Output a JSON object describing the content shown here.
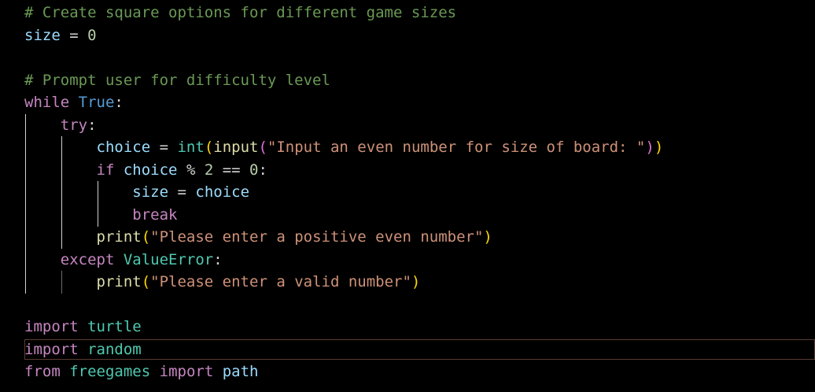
{
  "editor": {
    "language": "python",
    "lines": [
      {
        "tokens": [
          {
            "t": "# Create square options for different game sizes",
            "k": "comment"
          }
        ]
      },
      {
        "tokens": [
          {
            "t": "size",
            "k": "var"
          },
          {
            "t": " = ",
            "k": "op"
          },
          {
            "t": "0",
            "k": "num"
          }
        ]
      },
      {
        "tokens": []
      },
      {
        "tokens": [
          {
            "t": "# Prompt user for difficulty level",
            "k": "comment"
          }
        ]
      },
      {
        "tokens": [
          {
            "t": "while",
            "k": "keyword"
          },
          {
            "t": " ",
            "k": "op"
          },
          {
            "t": "True",
            "k": "const"
          },
          {
            "t": ":",
            "k": "op"
          }
        ]
      },
      {
        "tokens": [
          {
            "t": "    ",
            "k": "op"
          },
          {
            "t": "try",
            "k": "keyword"
          },
          {
            "t": ":",
            "k": "op"
          }
        ]
      },
      {
        "tokens": [
          {
            "t": "        ",
            "k": "op"
          },
          {
            "t": "choice",
            "k": "var"
          },
          {
            "t": " = ",
            "k": "op"
          },
          {
            "t": "int",
            "k": "class"
          },
          {
            "t": "(",
            "k": "paren1"
          },
          {
            "t": "input",
            "k": "func"
          },
          {
            "t": "(",
            "k": "paren2"
          },
          {
            "t": "\"Input an even number for size of board: \"",
            "k": "str"
          },
          {
            "t": ")",
            "k": "paren2"
          },
          {
            "t": ")",
            "k": "paren1"
          }
        ]
      },
      {
        "tokens": [
          {
            "t": "        ",
            "k": "op"
          },
          {
            "t": "if",
            "k": "keyword"
          },
          {
            "t": " ",
            "k": "op"
          },
          {
            "t": "choice",
            "k": "var"
          },
          {
            "t": " % ",
            "k": "op"
          },
          {
            "t": "2",
            "k": "num"
          },
          {
            "t": " == ",
            "k": "op"
          },
          {
            "t": "0",
            "k": "num"
          },
          {
            "t": ":",
            "k": "op"
          }
        ]
      },
      {
        "tokens": [
          {
            "t": "            ",
            "k": "op"
          },
          {
            "t": "size",
            "k": "var"
          },
          {
            "t": " = ",
            "k": "op"
          },
          {
            "t": "choice",
            "k": "var"
          }
        ]
      },
      {
        "tokens": [
          {
            "t": "            ",
            "k": "op"
          },
          {
            "t": "break",
            "k": "keyword"
          }
        ]
      },
      {
        "tokens": [
          {
            "t": "        ",
            "k": "op"
          },
          {
            "t": "print",
            "k": "func"
          },
          {
            "t": "(",
            "k": "paren1"
          },
          {
            "t": "\"Please enter a positive even number\"",
            "k": "str"
          },
          {
            "t": ")",
            "k": "paren1"
          }
        ]
      },
      {
        "tokens": [
          {
            "t": "    ",
            "k": "op"
          },
          {
            "t": "except",
            "k": "keyword"
          },
          {
            "t": " ",
            "k": "op"
          },
          {
            "t": "ValueError",
            "k": "class"
          },
          {
            "t": ":",
            "k": "op"
          }
        ]
      },
      {
        "tokens": [
          {
            "t": "        ",
            "k": "op"
          },
          {
            "t": "print",
            "k": "func"
          },
          {
            "t": "(",
            "k": "paren1"
          },
          {
            "t": "\"Please enter a valid number\"",
            "k": "str"
          },
          {
            "t": ")",
            "k": "paren1"
          }
        ]
      },
      {
        "tokens": []
      },
      {
        "tokens": [
          {
            "t": "import",
            "k": "keyword"
          },
          {
            "t": " ",
            "k": "op"
          },
          {
            "t": "turtle",
            "k": "class"
          }
        ]
      },
      {
        "tokens": [
          {
            "t": "import",
            "k": "keyword"
          },
          {
            "t": " ",
            "k": "op"
          },
          {
            "t": "random",
            "k": "class"
          }
        ]
      },
      {
        "tokens": [
          {
            "t": "from",
            "k": "keyword"
          },
          {
            "t": " ",
            "k": "op"
          },
          {
            "t": "freegames",
            "k": "class"
          },
          {
            "t": " ",
            "k": "op"
          },
          {
            "t": "import",
            "k": "keyword"
          },
          {
            "t": " ",
            "k": "op"
          },
          {
            "t": "path",
            "k": "var"
          }
        ]
      }
    ],
    "current_line_index": 15,
    "colors": {
      "background": "#000000",
      "comment": "#6a9955",
      "keyword": "#c586c0",
      "const": "#569cd6",
      "var": "#9cdcfe",
      "num": "#b5cea8",
      "op": "#d4d4d4",
      "func": "#dcdcaa",
      "class": "#4ec9b0",
      "str": "#ce9178",
      "paren1": "#ffd700",
      "paren2": "#da70d6",
      "current_line_border": "#5a3a33"
    }
  }
}
